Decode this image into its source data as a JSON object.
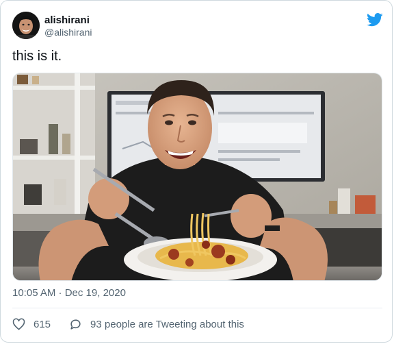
{
  "author": {
    "name": "alishirani",
    "handle": "@alishirani",
    "avatar_icon": "user-avatar"
  },
  "brand": {
    "icon": "twitter-bird-icon",
    "color": "#1d9bf0"
  },
  "tweet": {
    "text": "this is it.",
    "media": {
      "kind": "photo",
      "subject": "man in black t-shirt eating spaghetti at a kitchen counter, monitor in background"
    },
    "timestamp": "10:05 AM · Dec 19, 2020"
  },
  "actions": {
    "like_icon": "heart-icon",
    "like_count": "615",
    "reply_icon": "speech-bubble-icon",
    "conversation_label": "93 people are Tweeting about this"
  }
}
